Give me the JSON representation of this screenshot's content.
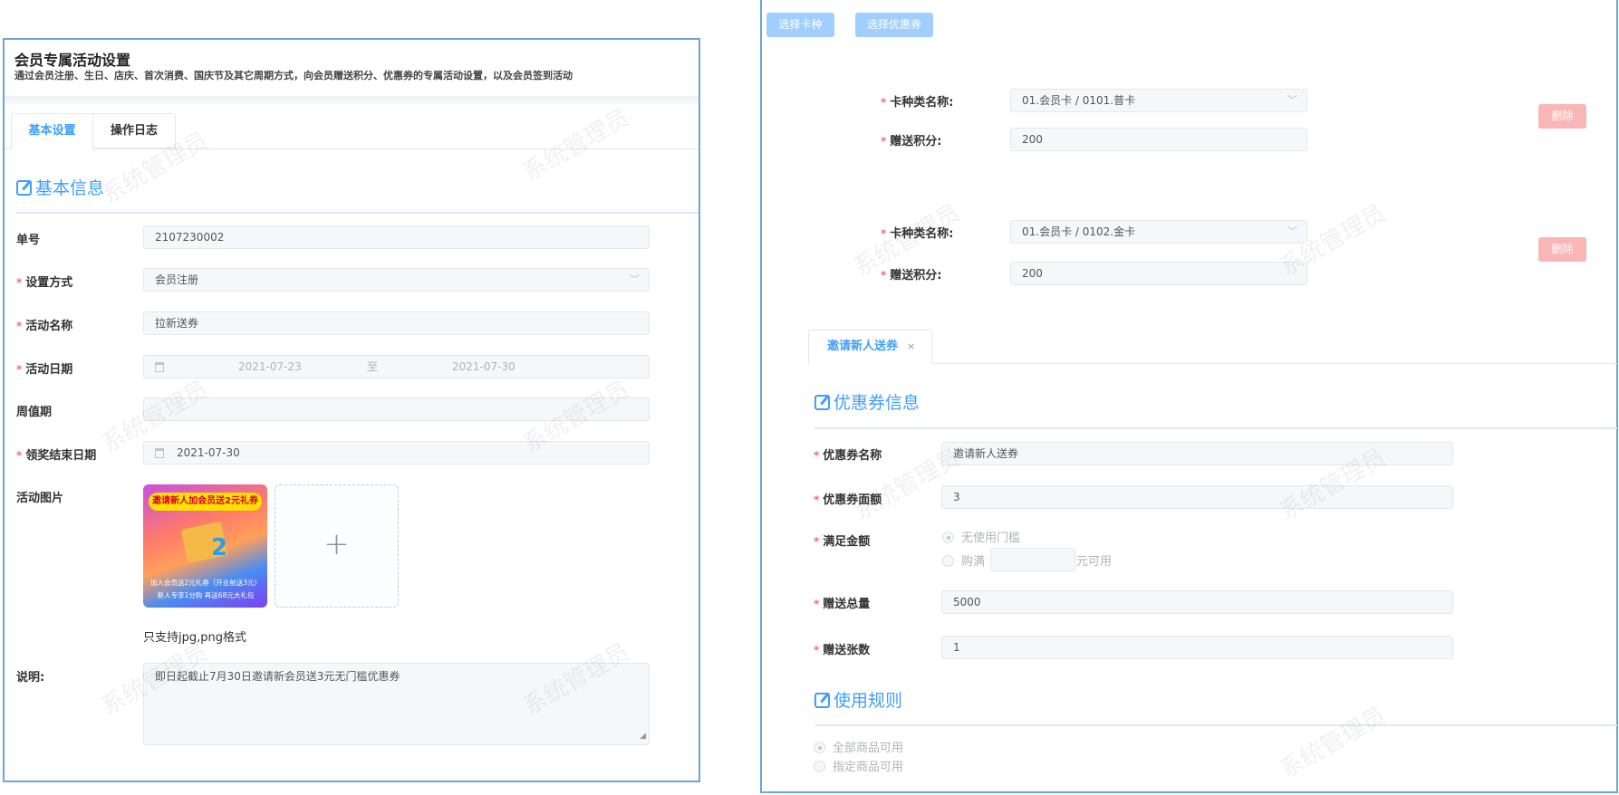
{
  "watermark": "系统管理员",
  "left": {
    "title": "会员专属活动设置",
    "subtitle": "通过会员注册、生日、店庆、首次消费、国庆节及其它周期方式，向会员赠送积分、优惠券的专属活动设置，以及会员签到活动",
    "tabs": [
      "基本设置",
      "操作日志"
    ],
    "section": "基本信息",
    "fields": {
      "order_no": {
        "label": "单号",
        "value": "2107230002"
      },
      "mode": {
        "label": "设置方式",
        "value": "会员注册"
      },
      "name": {
        "label": "活动名称",
        "value": "拉新送券"
      },
      "date": {
        "label": "活动日期",
        "start": "2021-07-23",
        "sep": "至",
        "end": "2021-07-30"
      },
      "period": {
        "label": "周值期",
        "value": ""
      },
      "end_date": {
        "label": "领奖结束日期",
        "value": "2021-07-30"
      },
      "image": {
        "label": "活动图片",
        "hint": "只支持jpg,png格式"
      },
      "desc": {
        "label": "说明:",
        "value": "即日起截止7月30日邀请新会员送3元无门槛优惠券"
      }
    },
    "banner": {
      "title": "邀请新人加会员送2元礼券",
      "line1": "加入会员送2元礼券（开业前送3元）",
      "line2": "新人专享1分购  再送68元大礼包"
    }
  },
  "right": {
    "buttons": {
      "select_card": "选择卡种",
      "select_coupon": "选择优惠券"
    },
    "cards": [
      {
        "type_label": "卡种类名称:",
        "type_value": "01.会员卡 / 0101.普卡",
        "points_label": "赠送积分:",
        "points": "200",
        "delete": "删除"
      },
      {
        "type_label": "卡种类名称:",
        "type_value": "01.会员卡 / 0102.金卡",
        "points_label": "赠送积分:",
        "points": "200",
        "delete": "删除"
      }
    ],
    "coupon_tab": "邀请新人送券",
    "coupon_section": "优惠券信息",
    "coupon": {
      "name": {
        "label": "优惠券名称",
        "value": "邀请新人送券"
      },
      "amount": {
        "label": "优惠券面额",
        "value": "3"
      },
      "threshold": {
        "label": "满足金额",
        "opt1": "无使用门槛",
        "opt2_pre": "购满",
        "opt2_post": "元可用",
        "opt2_value": ""
      },
      "total": {
        "label": "赠送总量",
        "value": "5000"
      },
      "count": {
        "label": "赠送张数",
        "value": "1"
      }
    },
    "rules_section": "使用规则",
    "rules": {
      "opt1": "全部商品可用",
      "opt2": "指定商品可用"
    }
  }
}
